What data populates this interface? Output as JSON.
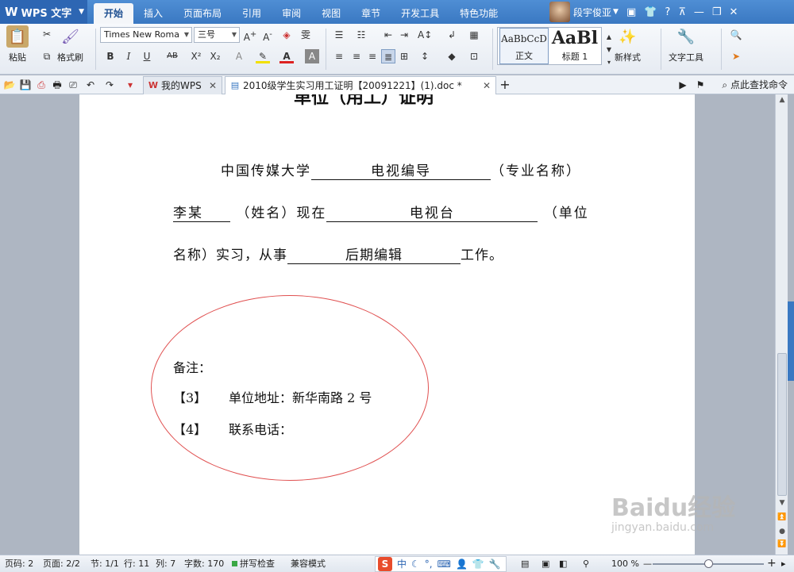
{
  "app": {
    "title": "WPS 文字"
  },
  "menu_tabs": [
    "开始",
    "插入",
    "页面布局",
    "引用",
    "审阅",
    "视图",
    "章节",
    "开发工具",
    "特色功能"
  ],
  "active_menu_tab": "开始",
  "user": {
    "name": "段宇俊亚"
  },
  "ribbon": {
    "paste_label": "粘贴",
    "format_painter_label": "格式刷",
    "font_name": "Times New Roma",
    "font_size": "三号",
    "styles": [
      {
        "sample": "AaBbCcD",
        "name": "正文"
      },
      {
        "sample": "AaBl",
        "name": "标题 1"
      }
    ],
    "new_style_label": "新样式",
    "text_tools_label": "文字工具"
  },
  "tabs": {
    "tab1_label": "我的WPS",
    "tab2_label": "2010级学生实习用工证明【20091221】(1).doc *",
    "find_command": "点此查找命令"
  },
  "document": {
    "heading": "单位（用工）证明",
    "line1": {
      "prefix": "中国传媒大学",
      "field": "电视编导",
      "suffix": "（专业名称）"
    },
    "line2": {
      "field1": "李某",
      "mid": "（姓名）现在",
      "field2": "电视台",
      "suffix": "（单位"
    },
    "line3": {
      "prefix": "名称）实习，从事",
      "field": "后期编辑",
      "suffix": "工作。"
    },
    "note_title": "备注：",
    "note_items": [
      {
        "num": "【3】",
        "text": "单位地址：新华南路 2 号"
      },
      {
        "num": "【4】",
        "text": "联系电话："
      }
    ]
  },
  "status": {
    "page_code": "页码: 2",
    "page": "页面: 2/2",
    "section": "节: 1/1",
    "row": "行: 11",
    "col": "列: 7",
    "word_count": "字数: 170",
    "spellcheck": "拼写检查",
    "compat": "兼容模式",
    "zoom": "100 %",
    "zoom_level": 0.5
  },
  "watermark": {
    "main": "Baidu经验",
    "sub": "jingyan.baidu.com"
  },
  "colors": {
    "accent": "#3a78c2",
    "ellipse": "#e05050"
  }
}
